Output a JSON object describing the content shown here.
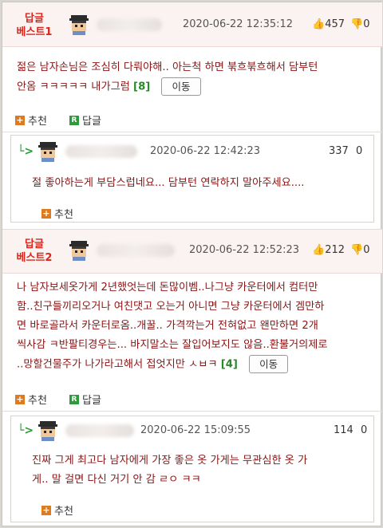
{
  "comments": [
    {
      "badge_line1": "답글",
      "badge_line2": "베스트1",
      "date": "2020-06-22 12:35:12",
      "up": "457",
      "down": "0",
      "text_line1": "젊은 남자손님은 조심히 다뤄야해.. 아는척 하면 붂흐붂흐해서 담부턴",
      "text_line2": "안옴 ㅋㅋㅋㅋㅋ 내가그럼",
      "reply_count": "[8]",
      "move_label": "이동",
      "recommend_label": "추천",
      "reply_label": "답글",
      "reply": {
        "arrow": "└>",
        "date": "2020-06-22 12:42:23",
        "up": "337",
        "down": "0",
        "text": "절 좋아하는게 부담스럽네요... 담부턴 연락하지 말아주세요....",
        "recommend_label": "추천"
      }
    },
    {
      "badge_line1": "답글",
      "badge_line2": "베스트2",
      "date": "2020-06-22 12:52:23",
      "up": "212",
      "down": "0",
      "text_line1": "나 남자보세옷가게 2년했엇는데 돈많이벰..나그냥 카운터에서 컴터만",
      "text_line2": "함..친구들끼리오거나 여친댓고 오는거 아니면 그냥 카운터에서 겜만하",
      "text_line3": "면 바로골라서 카운터로옴..개꿀.. 가격깍는거 전혀없고 왠만하면 2개",
      "text_line4": "씩사감 ㅋ반팔티경우는... 바지말소는 잘입어보지도 않음..환불거의제로",
      "text_line5": "..망할건물주가 나가라고해서 접엇지만 ㅅㅂㅋ",
      "reply_count": "[4]",
      "move_label": "이동",
      "recommend_label": "추천",
      "reply_label": "답글",
      "reply": {
        "arrow": "└>",
        "date": "2020-06-22 15:09:55",
        "up": "114",
        "down": "0",
        "text_line1": "진짜 그게 최고다 남자에게 가장 좋은 옷 가게는 무관심한 옷 가",
        "text_line2": "게.. 말 걸면 다신 거기 안 감 ㄹㅇ ㅋㅋ",
        "recommend_label": "추천"
      }
    }
  ],
  "icons": {
    "thumb_up": "thumb-up-icon",
    "thumb_down": "thumb-down-icon",
    "plus": "plus-icon",
    "reply_r": "reply-r-icon",
    "avatar": "pixel-avatar-icon"
  },
  "colors": {
    "accent_red": "#d8261c",
    "text_dark_red": "#8b1414",
    "count_green": "#2a8a2a",
    "reply_arrow_green": "#2e9a3a"
  }
}
